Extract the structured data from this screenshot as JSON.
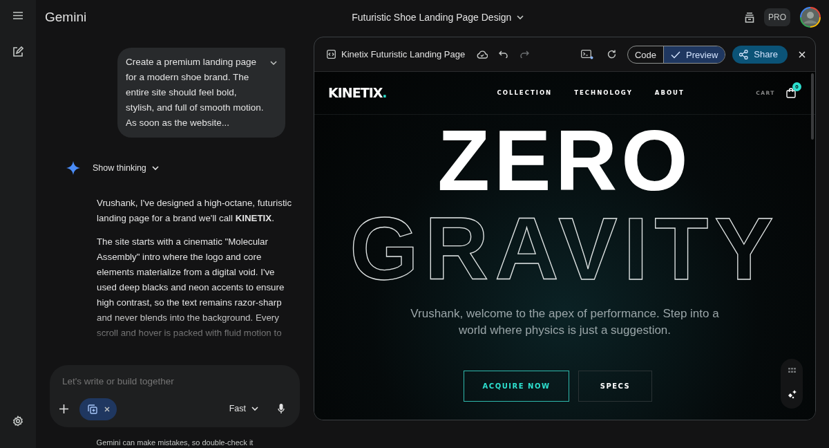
{
  "top_bar": {
    "app_name": "Gemini",
    "conversation_title": "Futuristic Shoe Landing Page Design",
    "badge": "PRO"
  },
  "chat": {
    "user_prompt": "Create a premium landing page for a modern shoe brand. The entire site should feel bold, stylish, and full of smooth motion. As soon as the website...",
    "thinking_label": "Show thinking",
    "response_paragraphs": [
      "Vrushank, I've designed a high-octane, futuristic landing page for a brand we'll call **KINETIX**.",
      "The site starts with a cinematic \"Molecular Assembly\" intro where the logo and core elements materialize from a digital void. I've used deep blacks and neon accents to ensure high contrast, so the text remains razor-sharp and never blends into the background. Every scroll and hover is packed with fluid motion to"
    ]
  },
  "composer": {
    "placeholder": "Let's write or build together",
    "mode": "Fast"
  },
  "disclaimer": "Gemini can make mistakes, so double-check it",
  "preview": {
    "title": "Kinetix Futuristic Landing Page",
    "view_tabs": [
      {
        "label": "Code",
        "selected": false
      },
      {
        "label": "Preview",
        "selected": true
      }
    ],
    "share": "Share"
  },
  "site": {
    "logo": "KINETIX",
    "logo_accent": ".",
    "nav": [
      "COLLECTION",
      "TECHNOLOGY",
      "ABOUT"
    ],
    "cart_label": "CART",
    "cart_count": "0",
    "headline": "ZERO",
    "headline_outline": "GRAVITY",
    "tagline": "Vrushank, welcome to the apex of performance. Step into a world where physics is just a suggestion.",
    "buttons": [
      {
        "label": "ACQUIRE NOW",
        "kind": "primary"
      },
      {
        "label": "SPECS",
        "kind": "secondary"
      }
    ]
  }
}
